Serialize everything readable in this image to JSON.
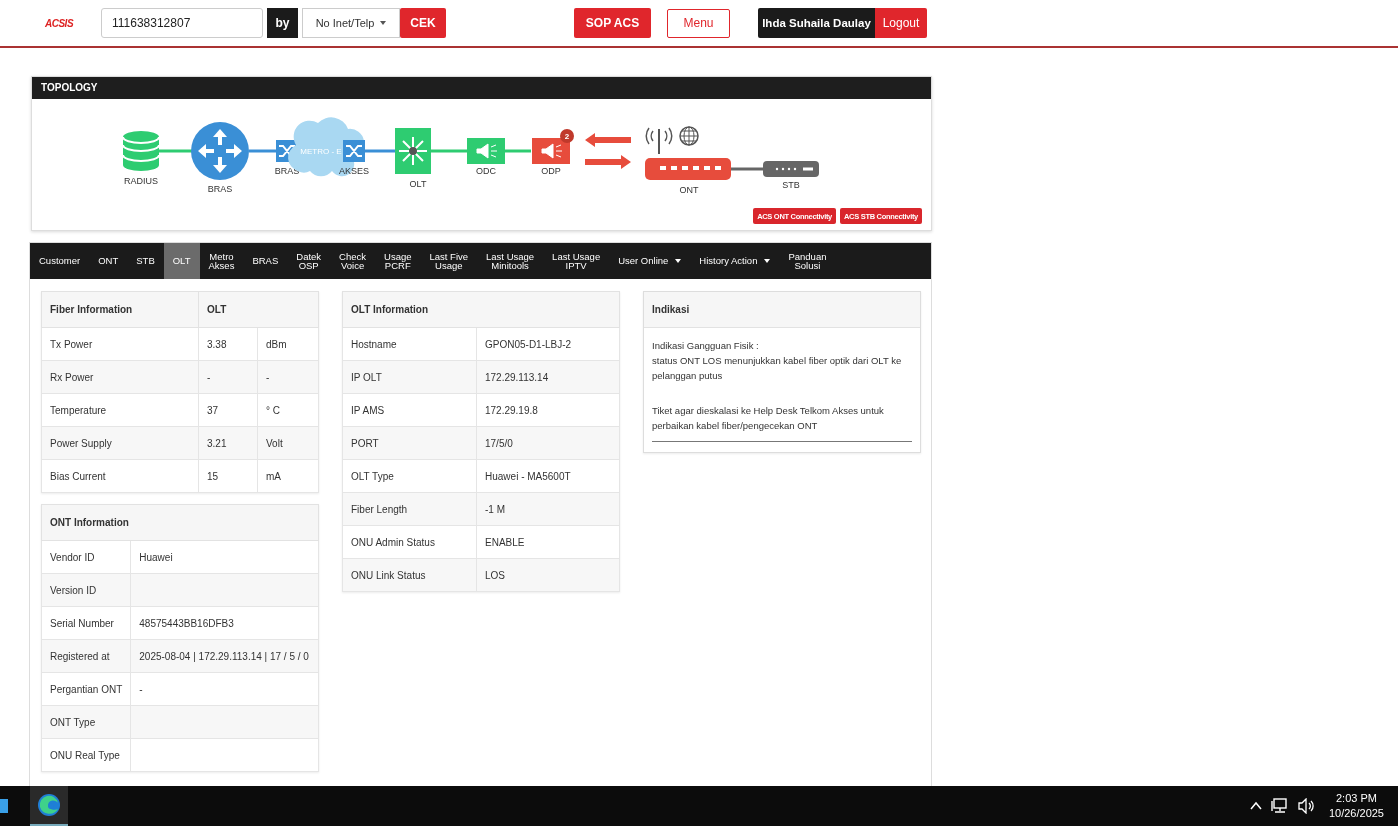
{
  "header": {
    "logo": "ACSIS",
    "search": {
      "value": "111638312807"
    },
    "by_label": "by",
    "search_type": "No Inet/Telp",
    "check_button": "CEK",
    "sop_button": "SOP ACS",
    "menu_button": "Menu",
    "user_name": "Ihda Suhaila Daulay",
    "logout_button": "Logout"
  },
  "topology": {
    "title": "TOPOLOGY",
    "nodes": [
      {
        "kind": "database",
        "label": "RADIUS"
      },
      {
        "kind": "router",
        "label": "BRAS"
      },
      {
        "kind": "switch",
        "label": "BRAS"
      },
      {
        "kind": "cloud",
        "label": "METRO - E"
      },
      {
        "kind": "switch",
        "label": "AKSES"
      },
      {
        "kind": "olt",
        "label": "OLT"
      },
      {
        "kind": "splitter",
        "label": "ODC",
        "color": "#2ecc71"
      },
      {
        "kind": "splitter",
        "label": "ODP",
        "color": "#e74c3c",
        "badge": "2"
      },
      {
        "kind": "ont",
        "label": "ONT"
      },
      {
        "kind": "stb",
        "label": "STB"
      }
    ],
    "buttons": [
      "ACS ONT Connectivity",
      "ACS STB Connectivity"
    ]
  },
  "tabs": [
    {
      "label": "Customer",
      "selected": false,
      "dropdown": false
    },
    {
      "label": "ONT",
      "selected": false,
      "dropdown": false
    },
    {
      "label": "STB",
      "selected": false,
      "dropdown": false
    },
    {
      "label": "OLT",
      "selected": true,
      "dropdown": false
    },
    {
      "label": "Metro\nAkses",
      "selected": false,
      "dropdown": false
    },
    {
      "label": "BRAS",
      "selected": false,
      "dropdown": false
    },
    {
      "label": "Datek\nOSP",
      "selected": false,
      "dropdown": false
    },
    {
      "label": "Check\nVoice",
      "selected": false,
      "dropdown": false
    },
    {
      "label": "Usage\nPCRF",
      "selected": false,
      "dropdown": false
    },
    {
      "label": "Last Five\nUsage",
      "selected": false,
      "dropdown": false
    },
    {
      "label": "Last Usage\nMinitools",
      "selected": false,
      "dropdown": false
    },
    {
      "label": "Last Usage\nIPTV",
      "selected": false,
      "dropdown": false
    },
    {
      "label": "User Online",
      "selected": false,
      "dropdown": true
    },
    {
      "label": "History Action",
      "selected": false,
      "dropdown": true
    },
    {
      "label": "Panduan\nSolusi",
      "selected": false,
      "dropdown": false
    }
  ],
  "fiber_information": {
    "headers": [
      "Fiber Information",
      "OLT"
    ],
    "rows": [
      [
        "Tx Power",
        "3.38",
        "dBm"
      ],
      [
        "Rx Power",
        "-",
        "-"
      ],
      [
        "Temperature",
        "37",
        "° C"
      ],
      [
        "Power Supply",
        "3.21",
        "Volt"
      ],
      [
        "Bias Current",
        "15",
        "mA"
      ]
    ]
  },
  "ont_information": {
    "title": "ONT Information",
    "rows": [
      [
        "Vendor ID",
        "Huawei"
      ],
      [
        "Version ID",
        ""
      ],
      [
        "Serial Number",
        "48575443BB16DFB3"
      ],
      [
        "Registered at",
        "2025-08-04 | 172.29.113.14 | 17 / 5 / 0"
      ],
      [
        "Pergantian ONT",
        "-"
      ],
      [
        "ONT Type",
        ""
      ],
      [
        "ONU Real Type",
        ""
      ]
    ]
  },
  "olt_information": {
    "title": "OLT Information",
    "rows": [
      [
        "Hostname",
        "GPON05-D1-LBJ-2"
      ],
      [
        "IP OLT",
        "172.29.113.14"
      ],
      [
        "IP AMS",
        "172.29.19.8"
      ],
      [
        "PORT",
        "17/5/0"
      ],
      [
        "OLT Type",
        "Huawei - MA5600T"
      ],
      [
        "Fiber Length",
        "-1 M"
      ],
      [
        "ONU Admin Status",
        "ENABLE"
      ],
      [
        "ONU Link Status",
        "LOS"
      ]
    ]
  },
  "indikasi": {
    "title": "Indikasi",
    "lines": [
      "Indikasi Gangguan Fisik :",
      "status ONT LOS menunjukkan kabel fiber optik dari OLT ke pelanggan putus"
    ],
    "note": "Tiket agar dieskalasi ke Help Desk Telkom Akses untuk perbaikan kabel fiber/pengecekan ONT"
  },
  "taskbar": {
    "time": "2:03 PM",
    "date": "10/26/2025"
  }
}
